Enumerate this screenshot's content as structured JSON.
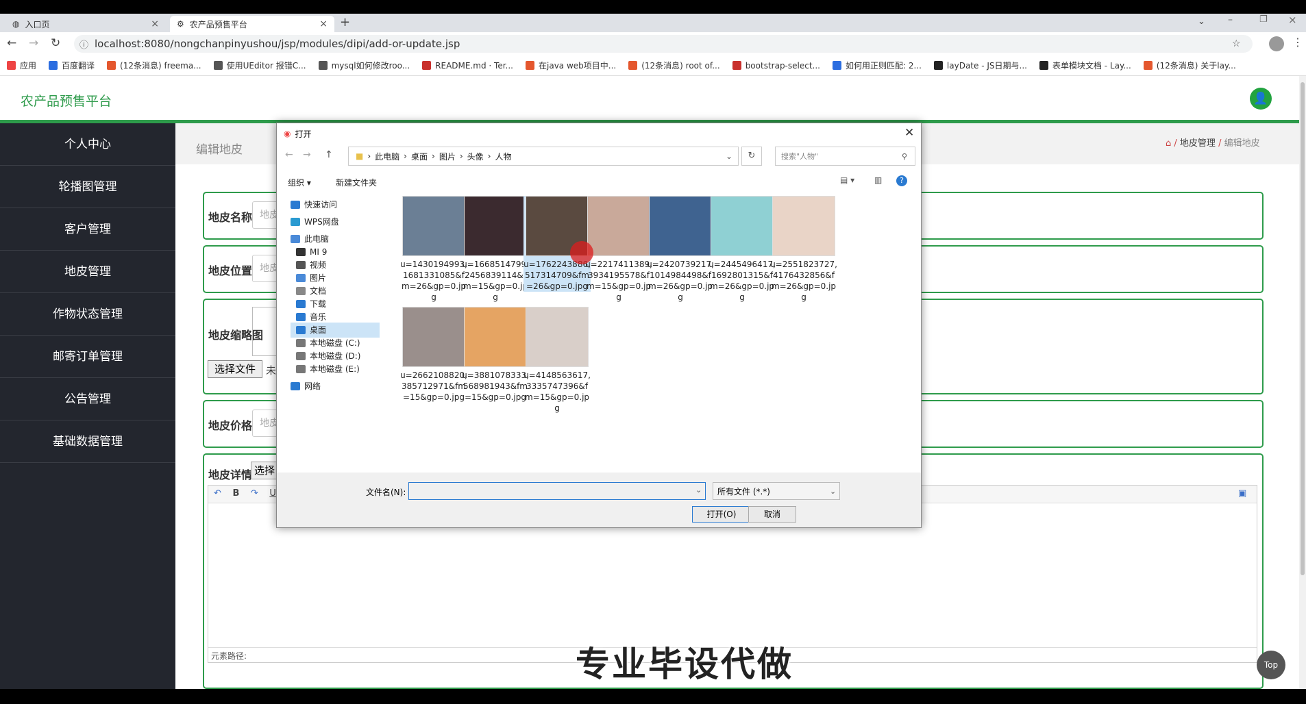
{
  "browser": {
    "tabs": [
      {
        "label": "入口页"
      },
      {
        "label": "农产品预售平台"
      }
    ],
    "url": "localhost:8080/nongchanpinyushou/jsp/modules/dipi/add-or-update.jsp",
    "bookmarks": [
      {
        "label": "应用",
        "color": "#e44"
      },
      {
        "label": "百度翻译",
        "color": "#2b6de0"
      },
      {
        "label": "(12条消息) freema...",
        "color": "#e4572e"
      },
      {
        "label": "使用UEditor 报错C...",
        "color": "#555"
      },
      {
        "label": "mysql如何修改roo...",
        "color": "#555"
      },
      {
        "label": "README.md · Ter...",
        "color": "#c9302c"
      },
      {
        "label": "在java web项目中...",
        "color": "#e4572e"
      },
      {
        "label": "(12条消息) root of...",
        "color": "#e4572e"
      },
      {
        "label": "bootstrap-select...",
        "color": "#c9302c"
      },
      {
        "label": "如何用正则匹配: 2...",
        "color": "#2b6de0"
      },
      {
        "label": "layDate - JS日期与...",
        "color": "#222"
      },
      {
        "label": "表单模块文档 - Lay...",
        "color": "#222"
      },
      {
        "label": "(12条消息) 关于lay...",
        "color": "#e4572e"
      }
    ]
  },
  "app": {
    "brand": "农产品预售平台",
    "sidebar": [
      "个人中心",
      "轮播图管理",
      "客户管理",
      "地皮管理",
      "作物状态管理",
      "邮寄订单管理",
      "公告管理",
      "基础数据管理"
    ],
    "page_title": "编辑地皮",
    "breadcrumb": {
      "section": "地皮管理",
      "current": "编辑地皮"
    },
    "form": {
      "name_label": "地皮名称",
      "name_placeholder": "地皮",
      "location_label": "地皮位置",
      "location_placeholder": "地皮",
      "thumb_label": "地皮缩略图",
      "choose_file": "选择文件",
      "no_file": "未",
      "price_label": "地皮价格",
      "price_placeholder": "地皮",
      "detail_label": "地皮详情",
      "detail_choose": "选择",
      "element_path": "元素路径:"
    },
    "top_button": "Top",
    "watermark": "专业毕设代做"
  },
  "dialog": {
    "title": "打开",
    "path": [
      "此电脑",
      "桌面",
      "图片",
      "头像",
      "人物"
    ],
    "search_placeholder": "搜索\"人物\"",
    "organize": "组织",
    "new_folder": "新建文件夹",
    "nav": [
      "快速访问",
      "WPS网盘",
      "此电脑",
      "MI 9",
      "视频",
      "图片",
      "文档",
      "下载",
      "音乐",
      "桌面",
      "本地磁盘 (C:)",
      "本地磁盘 (D:)",
      "本地磁盘 (E:)",
      "网络"
    ],
    "files": [
      {
        "name": "u=1430194993,1681331085&fm=26&gp=0.jpg",
        "color": "#6b7f95"
      },
      {
        "name": "u=1668514799,2456839114&fm=15&gp=0.jpg",
        "color": "#3b2a2f"
      },
      {
        "name": "u=1762243886,517314709&fm=26&gp=0.jpg",
        "color": "#5a4a40"
      },
      {
        "name": "u=2217411389,3934195578&fm=15&gp=0.jpg",
        "color": "#c9a99a"
      },
      {
        "name": "u=2420739217,1014984498&fm=26&gp=0.jpg",
        "color": "#3f6390"
      },
      {
        "name": "u=2445496417,1692801315&fm=26&gp=0.jpg",
        "color": "#8fd0d3"
      },
      {
        "name": "u=2551823727,4176432856&fm=26&gp=0.jpg",
        "color": "#e9d4c7"
      },
      {
        "name": "u=2662108820,385712971&fm=15&gp=0.jpg",
        "color": "#9a8f8c"
      },
      {
        "name": "u=3881078333,568981943&fm=15&gp=0.jpg",
        "color": "#e5a463"
      },
      {
        "name": "u=4148563617,3335747396&fm=15&gp=0.jpg",
        "color": "#d9cfc9"
      }
    ],
    "filename_label": "文件名(N):",
    "filename_value": "",
    "filter": "所有文件 (*.*)",
    "open_button": "打开(O)",
    "cancel_button": "取消"
  }
}
